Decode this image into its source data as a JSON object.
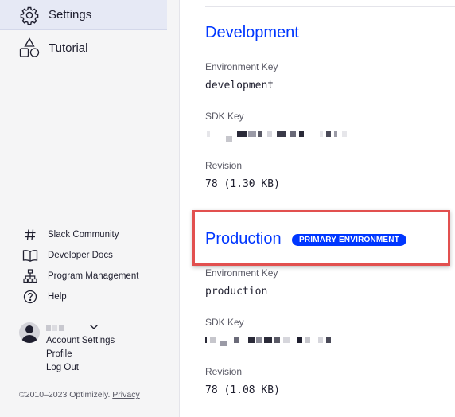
{
  "sidebar": {
    "nav": [
      {
        "label": "Settings",
        "icon": "gear-icon",
        "active": true
      },
      {
        "label": "Tutorial",
        "icon": "shapes-icon",
        "active": false
      }
    ],
    "links": [
      {
        "label": "Slack Community",
        "icon": "hash-icon"
      },
      {
        "label": "Developer Docs",
        "icon": "book-icon"
      },
      {
        "label": "Program Management",
        "icon": "org-chart-icon"
      },
      {
        "label": "Help",
        "icon": "question-icon"
      }
    ],
    "account": {
      "avatar_icon": "user-avatar-icon",
      "menu_icon": "chevron-down-icon",
      "links": [
        "Account Settings",
        "Profile",
        "Log Out"
      ]
    },
    "footer": {
      "copyright": "©2010–2023 Optimizely.",
      "privacy": "Privacy"
    }
  },
  "main": {
    "environments": [
      {
        "name": "Development",
        "env_key_label": "Environment Key",
        "env_key": "development",
        "sdk_key_label": "SDK Key",
        "revision_label": "Revision",
        "revision": "78 (1.30 KB)"
      },
      {
        "name": "Production",
        "badge": "PRIMARY ENVIRONMENT",
        "env_key_label": "Environment Key",
        "env_key": "production",
        "sdk_key_label": "SDK Key",
        "revision_label": "Revision",
        "revision": "78 (1.08 KB)"
      }
    ]
  },
  "colors": {
    "accent": "#0037ff",
    "highlight": "#e2504f",
    "sidebar_bg": "#f5f5f6",
    "active_nav_bg": "#e6e9f5"
  }
}
